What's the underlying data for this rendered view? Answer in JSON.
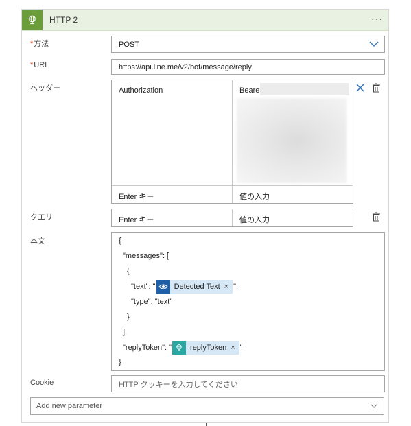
{
  "action": {
    "title": "HTTP 2",
    "more_label": "···",
    "header_color": "#e8f1e2",
    "icon_color": "#6b9d3a",
    "icon": "globe-icon"
  },
  "fields": {
    "method": {
      "required_mark": "*",
      "label": "方法",
      "value": "POST"
    },
    "uri": {
      "required_mark": "*",
      "label": "URI",
      "value": "https://api.line.me/v2/bot/message/reply"
    },
    "headers": {
      "label": "ヘッダー",
      "rows": [
        {
          "key": "Authorization",
          "value": "Bearer"
        }
      ],
      "key_placeholder": "Enter キー",
      "value_placeholder": "値の入力"
    },
    "queries": {
      "label": "クエリ",
      "key_placeholder": "Enter キー",
      "value_placeholder": "値の入力"
    },
    "body": {
      "label": "本文",
      "lines": {
        "l1": "{",
        "l2": "\"messages\": [",
        "l3": "{",
        "l4_prefix": "\"text\": \"",
        "l4_suffix": "\",",
        "l5": "\"type\": \"text\"",
        "l6": "}",
        "l7": "],",
        "l8_prefix": "\"replyToken\": \"",
        "l8_suffix": "\"",
        "l9": "}"
      },
      "tokens": {
        "detected_text": {
          "label": "Detected Text",
          "remove": "×",
          "icon": "eye-icon",
          "icon_color": "#1f5fa8"
        },
        "reply_token": {
          "label": "replyToken",
          "remove": "×",
          "icon": "globe-icon",
          "icon_color": "#2aa7a2"
        }
      }
    },
    "cookie": {
      "label": "Cookie",
      "placeholder": "HTTP クッキーを入力してください"
    }
  },
  "add_parameter": {
    "placeholder": "Add new parameter"
  }
}
